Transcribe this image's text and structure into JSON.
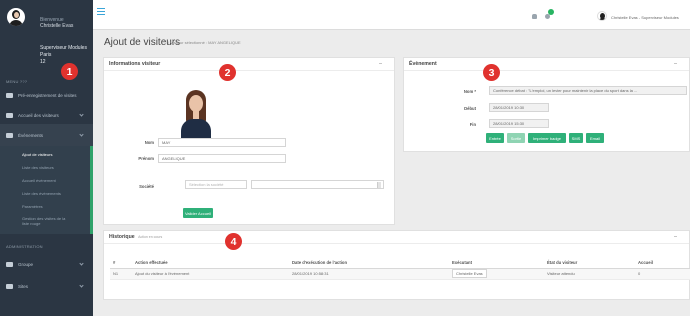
{
  "sidebar": {
    "welcome": "Bienvenue",
    "user_name": "Christelle Evas",
    "role_line1": "Superviseur Modules",
    "role_line2": "Paris",
    "role_line3": "12",
    "section_main": "MENU ???",
    "items": [
      {
        "label": "Pré-enregistrement de visites"
      },
      {
        "label": "Accueil des visiteurs"
      },
      {
        "label": "Évènements"
      }
    ],
    "submenu": [
      {
        "label": "Ajout de visiteurs"
      },
      {
        "label": "Liste des visiteurs"
      },
      {
        "label": "Accueil évènement"
      },
      {
        "label": "Liste des évènements"
      },
      {
        "label": "Paramètres"
      },
      {
        "label": "Gestion des visites de la liste rouge"
      }
    ],
    "section_admin": "ADMINISTRATION",
    "items_admin": [
      {
        "label": "Groupe"
      },
      {
        "label": "Sites"
      }
    ]
  },
  "topbar": {
    "user": "Christelle Evas - Superviseur Modules"
  },
  "page": {
    "title": "Ajout de visiteurs",
    "breadcrumb": "/ Visiteur sélectionné : MAY ANGELIQUE"
  },
  "visitor_info": {
    "title": "Informations visiteur",
    "nom_label": "Nom",
    "nom_value": "MAY",
    "prenom_label": "Prénom",
    "prenom_value": "ANGELIQUE",
    "societe_label": "Société",
    "societe_placeholder": "Sélection la société",
    "button": "Valider Accueil"
  },
  "event": {
    "title": "Évènement",
    "nom_label": "Nom *",
    "nom_value": "Conférence débat : \"L'emploi, un levier pour maintenir la place du sport dans la ...",
    "debut_label": "Début",
    "debut_value": "28/01/2019 10:30",
    "fin_label": "Fin",
    "fin_value": "28/01/2019 15:30",
    "buttons": [
      "Entrée",
      "Sortie",
      "Imprimer badge",
      "SMS",
      "Email"
    ]
  },
  "history": {
    "title": "Historique",
    "subtitle": "Action en cours",
    "columns": [
      "#",
      "Action effectuée",
      "Date d'exécution de l'action",
      "Exécutant",
      "État du visiteur",
      "Accueil"
    ],
    "rows": [
      [
        "N1",
        "Ajout du visiteur à l'évènement",
        "28/01/2019 10:58:31",
        "Christelle Evas",
        "Visiteur attendu",
        "0"
      ]
    ]
  },
  "markers": [
    "1",
    "2",
    "3",
    "4"
  ],
  "colors": {
    "sidebar": "#2b3643",
    "accent_green": "#2fb079",
    "marker_red": "#e0322e"
  }
}
